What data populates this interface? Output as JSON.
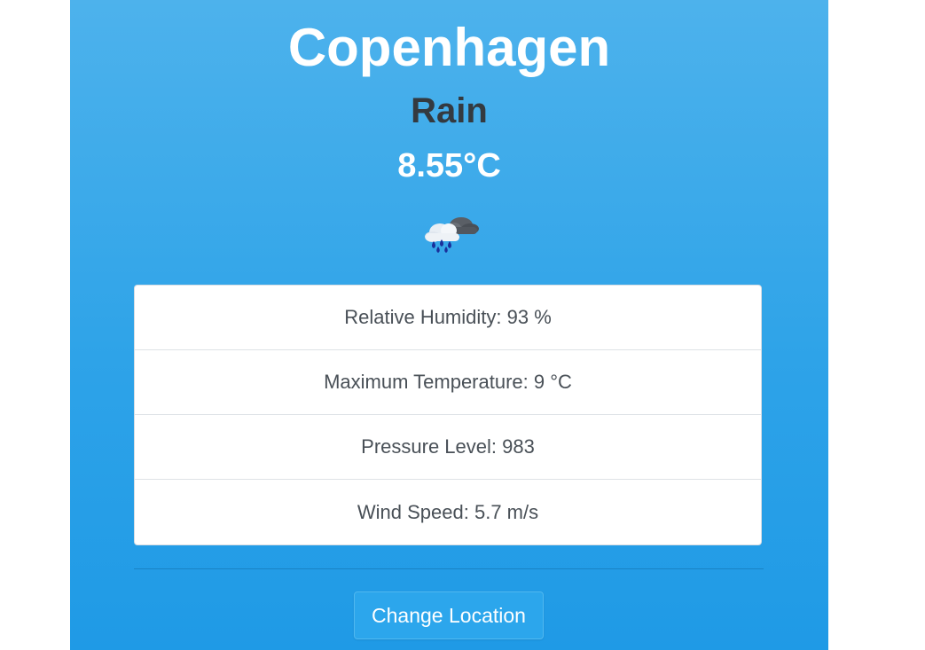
{
  "location": {
    "city": "Copenhagen",
    "condition": "Rain",
    "temperature": "8.55°C",
    "weather_icon": "rain-cloud-icon"
  },
  "details": [
    {
      "label": "Relative Humidity: 93 %"
    },
    {
      "label": "Maximum Temperature: 9 °C"
    },
    {
      "label": "Pressure Level: 983"
    },
    {
      "label": "Wind Speed: 5.7 m/s"
    }
  ],
  "actions": {
    "change_location_label": "Change Location"
  },
  "colors": {
    "panel_top": "#4db2ec",
    "panel_bottom": "#1f9ae6",
    "button": "#2ca6ec",
    "condition_text": "#343a40"
  }
}
